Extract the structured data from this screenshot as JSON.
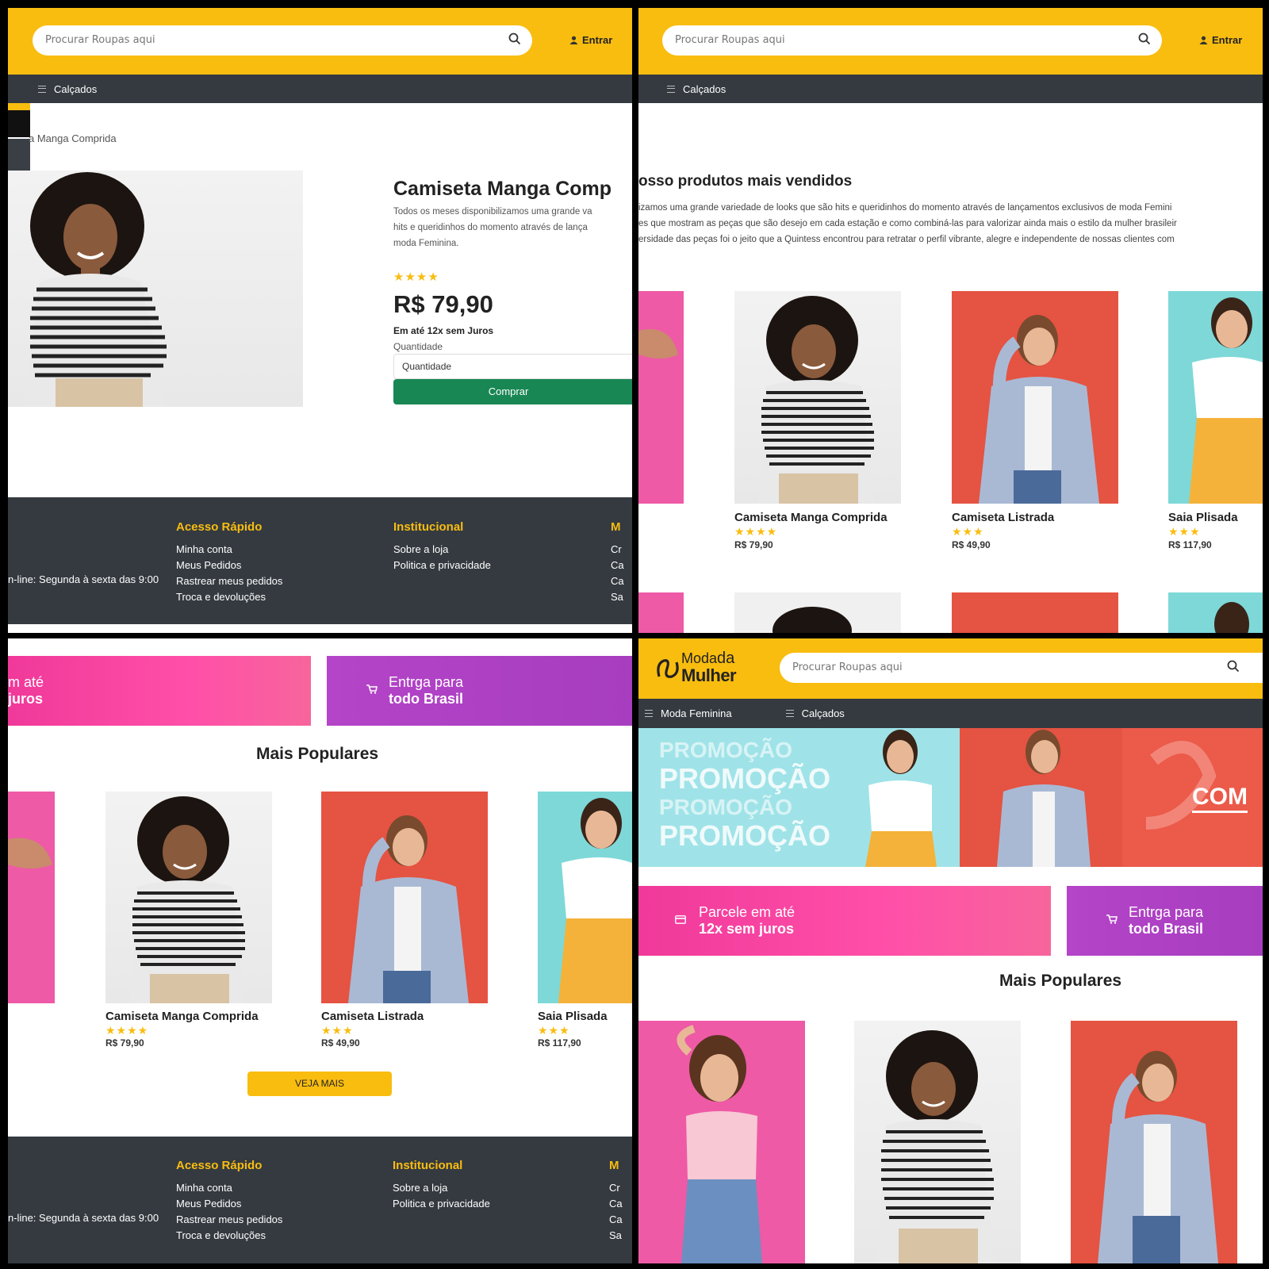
{
  "header": {
    "search_placeholder": "Procurar Roupas aqui",
    "login_label": "Entrar",
    "brand_line1": "Moda",
    "brand_line1b": "da",
    "brand_line2": "Mulher"
  },
  "nav": {
    "moda_feminina": "Moda Feminina",
    "calcados": "Calçados"
  },
  "product_page": {
    "breadcrumb": "a Manga Comprida",
    "title": "Camiseta Manga Comp",
    "description_lines": [
      "Todos os meses disponibilizamos uma grande va",
      "hits e queridinhos do momento através de lança",
      "moda Feminina."
    ],
    "rating_stars": "★★★★",
    "price": "R$ 79,90",
    "installments": "Em até 12x sem Juros",
    "quantity_label": "Quantidade",
    "quantity_placeholder": "Quantidade",
    "buy_label": "Comprar"
  },
  "best_sellers": {
    "title": "osso produtos mais vendidos",
    "description_lines": [
      "izamos uma grande variedade de looks que são hits e queridinhos do momento através de lançamentos exclusivos de moda Femini",
      "es que mostram as peças que são desejo em cada estação e como combiná-las para valorizar ainda mais o estilo da mulher brasileir",
      "ersidade das peças foi o jeito que a Quintess encontrou para retratar o perfil vibrante, alegre e independente de nossas clientes com"
    ]
  },
  "products": [
    {
      "name": "Camiseta Manga Comprida",
      "stars": "★★★★",
      "price": "R$ 79,90"
    },
    {
      "name": "Camiseta Listrada",
      "stars": "★★★",
      "price": "R$ 49,90"
    },
    {
      "name": "Saia Plisada",
      "stars": "★★★",
      "price": "R$ 117,90"
    }
  ],
  "banners": {
    "installments_line1": "Parcele em até",
    "installments_line2": "12x sem juros",
    "installments_crop1": "m até",
    "installments_crop2": "juros",
    "shipping_line1": "Entrga para",
    "shipping_line2": "todo Brasil"
  },
  "popular": {
    "title": "Mais Populares",
    "more_label": "VEJA MAIS"
  },
  "promo": {
    "word": "PROMOÇÃO",
    "cta_crop": "COM"
  },
  "footer": {
    "hours": "n-line: Segunda à sexta das 9:00",
    "quick_title": "Acesso Rápido",
    "quick_links": [
      "Minha conta",
      "Meus Pedidos",
      "Rastrear meus pedidos",
      "Troca e devoluções"
    ],
    "inst_title": "Institucional",
    "inst_links": [
      "Sobre a loja",
      "Politica e privacidade"
    ],
    "third_title_crop": "M",
    "third_links_crop": [
      "Cr",
      "Ca",
      "Ca",
      "Sa"
    ]
  },
  "colors": {
    "brand_yellow": "#f9bd10",
    "dark": "#343a40",
    "buy_green": "#198754",
    "pink": "#f0399a",
    "purple": "#b444c8"
  }
}
